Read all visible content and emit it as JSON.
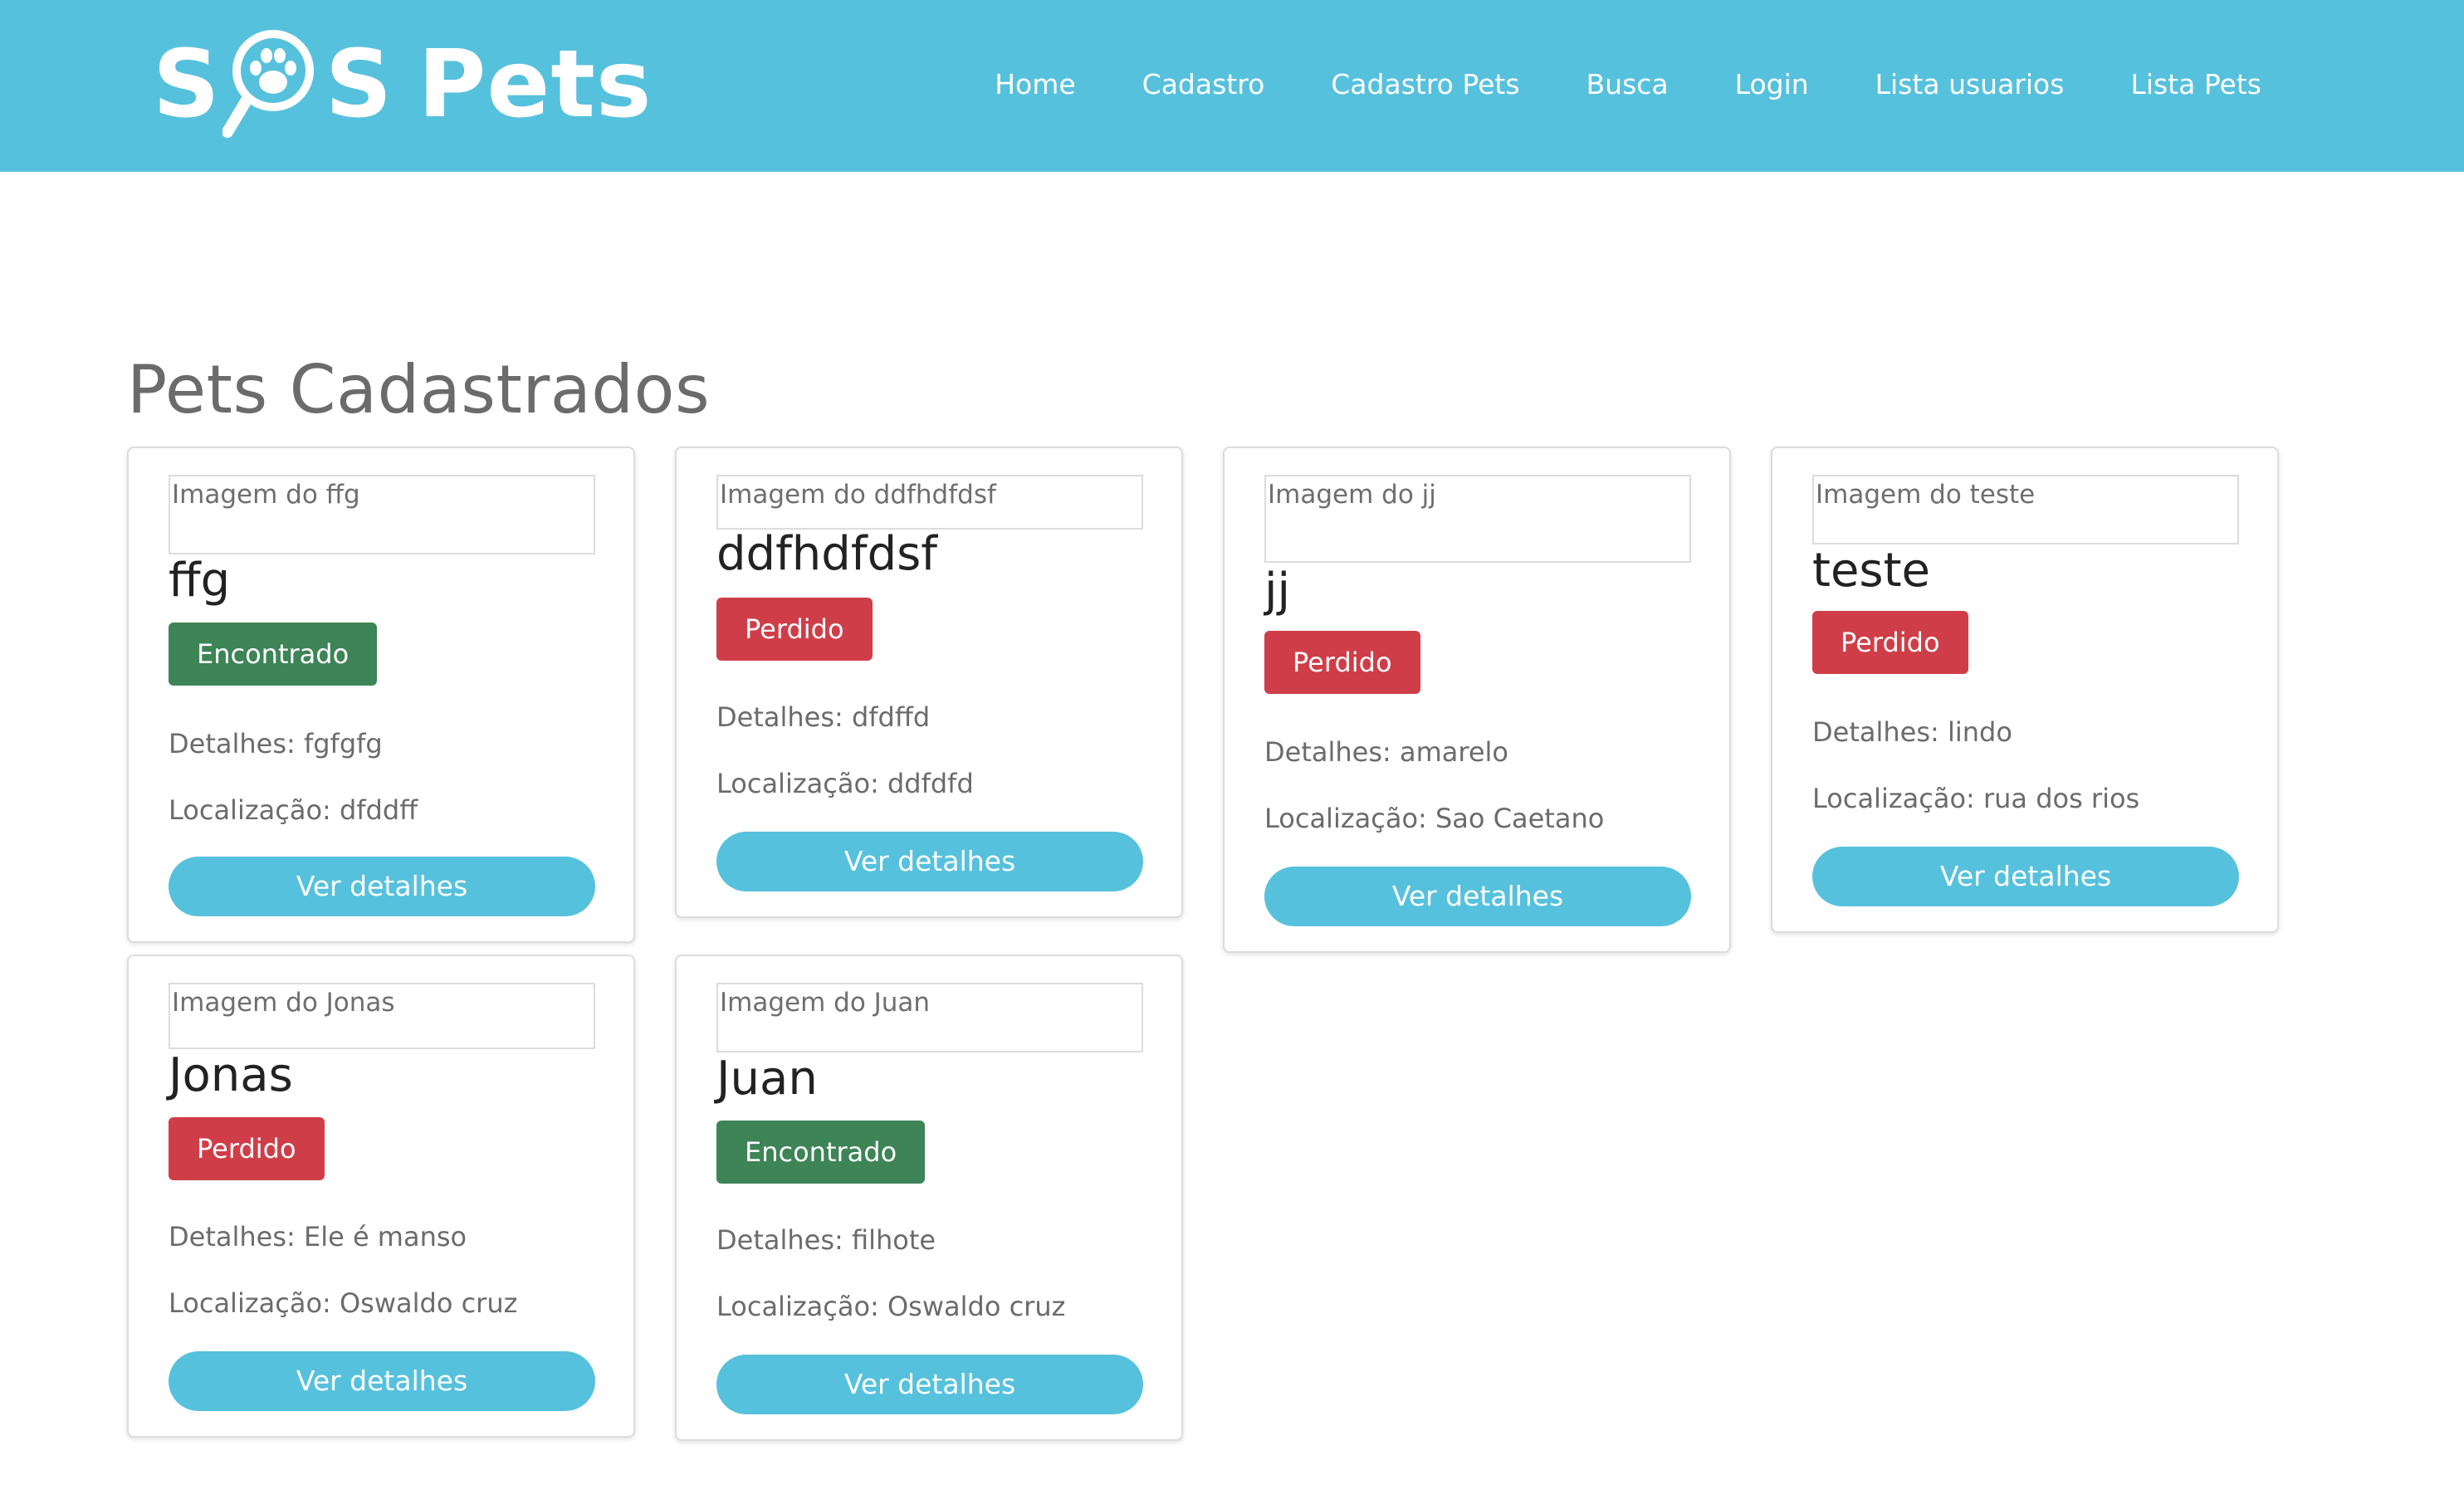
{
  "brand": {
    "text_before": "S",
    "text_after": "S",
    "word2": "Pets",
    "color": "#ffffff"
  },
  "colors": {
    "header_bg": "#56c1dd",
    "found": "#3d8456",
    "lost": "#cf3e48",
    "button": "#56c1dd"
  },
  "nav": {
    "items": [
      "Home",
      "Cadastro",
      "Cadastro Pets",
      "Busca",
      "Login",
      "Lista usuarios",
      "Lista Pets"
    ]
  },
  "page_title": "Pets Cadastrados",
  "pets": [
    {
      "image_alt": "Imagem do ffg",
      "name": "ffg",
      "status": "Encontrado",
      "details": "Detalhes: fgfgfg",
      "location": "Localização: dfddff",
      "button": "Ver detalhes"
    },
    {
      "image_alt": "Imagem do ddfhdfdsf",
      "name": "ddfhdfdsf",
      "status": "Perdido",
      "details": "Detalhes: dfdffd",
      "location": "Localização: ddfdfd",
      "button": "Ver detalhes"
    },
    {
      "image_alt": "Imagem do jj",
      "name": "jj",
      "status": "Perdido",
      "details": "Detalhes: amarelo",
      "location": "Localização: Sao Caetano",
      "button": "Ver detalhes"
    },
    {
      "image_alt": "Imagem do teste",
      "name": "teste",
      "status": "Perdido",
      "details": "Detalhes: lindo",
      "location": "Localização: rua dos rios",
      "button": "Ver detalhes"
    },
    {
      "image_alt": "Imagem do Jonas",
      "name": "Jonas",
      "status": "Perdido",
      "details": "Detalhes: Ele é manso",
      "location": "Localização: Oswaldo cruz",
      "button": "Ver detalhes"
    },
    {
      "image_alt": "Imagem do Juan",
      "name": "Juan",
      "status": "Encontrado",
      "details": "Detalhes: filhote",
      "location": "Localização: Oswaldo cruz",
      "button": "Ver detalhes"
    }
  ]
}
